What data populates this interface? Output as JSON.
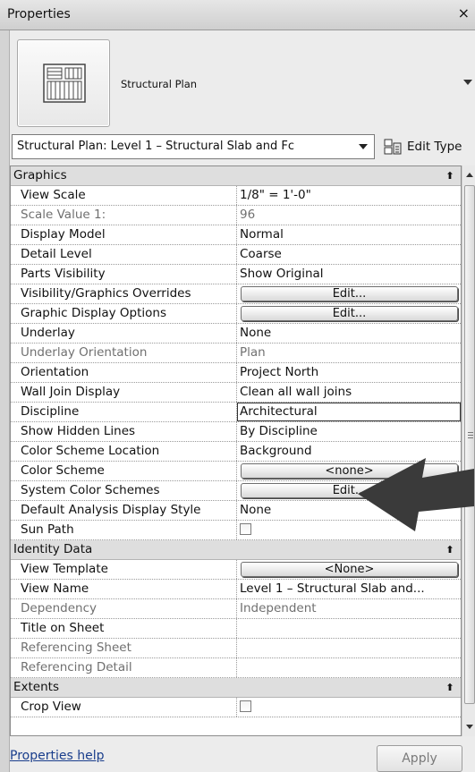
{
  "window": {
    "title": "Properties",
    "close_glyph": "×"
  },
  "type_selector": {
    "icon": "structural-plan-icon",
    "name": "Structural Plan"
  },
  "instance_selector": {
    "value": "Structural Plan: Level 1 – Structural Slab and Fc",
    "edit_type_label": "Edit Type"
  },
  "groups": {
    "graphics": {
      "label": "Graphics",
      "rows": [
        {
          "name": "View Scale",
          "value": "1/8\" = 1'-0\""
        },
        {
          "name": "Scale Value    1:",
          "value": "96"
        },
        {
          "name": "Display Model",
          "value": "Normal"
        },
        {
          "name": "Detail Level",
          "value": "Coarse"
        },
        {
          "name": "Parts Visibility",
          "value": "Show Original"
        },
        {
          "name": "Visibility/Graphics Overrides",
          "value": "Edit..."
        },
        {
          "name": "Graphic Display Options",
          "value": "Edit..."
        },
        {
          "name": "Underlay",
          "value": "None"
        },
        {
          "name": "Underlay Orientation",
          "value": "Plan"
        },
        {
          "name": "Orientation",
          "value": "Project North"
        },
        {
          "name": "Wall Join Display",
          "value": "Clean all wall joins"
        },
        {
          "name": "Discipline",
          "value": "Architectural"
        },
        {
          "name": "Show Hidden Lines",
          "value": "By Discipline"
        },
        {
          "name": "Color Scheme Location",
          "value": "Background"
        },
        {
          "name": "Color Scheme",
          "value": "<none>"
        },
        {
          "name": "System Color Schemes",
          "value": "Edit..."
        },
        {
          "name": "Default Analysis Display Style",
          "value": "None"
        },
        {
          "name": "Sun Path",
          "value": ""
        }
      ]
    },
    "identity": {
      "label": "Identity Data",
      "rows": [
        {
          "name": "View Template",
          "value": "<None>"
        },
        {
          "name": "View Name",
          "value": "Level 1 – Structural Slab and..."
        },
        {
          "name": "Dependency",
          "value": "Independent"
        },
        {
          "name": "Title on Sheet",
          "value": ""
        },
        {
          "name": "Referencing Sheet",
          "value": ""
        },
        {
          "name": "Referencing Detail",
          "value": ""
        }
      ]
    },
    "extents": {
      "label": "Extents",
      "rows": [
        {
          "name": "Crop View",
          "value": ""
        }
      ]
    }
  },
  "footer": {
    "help_label": "Properties help",
    "apply_label": "Apply"
  },
  "colors": {
    "panel": "#ececec",
    "group_header": "#dedede",
    "arrow": "#3a3a3a",
    "link": "#1a3e8c"
  }
}
